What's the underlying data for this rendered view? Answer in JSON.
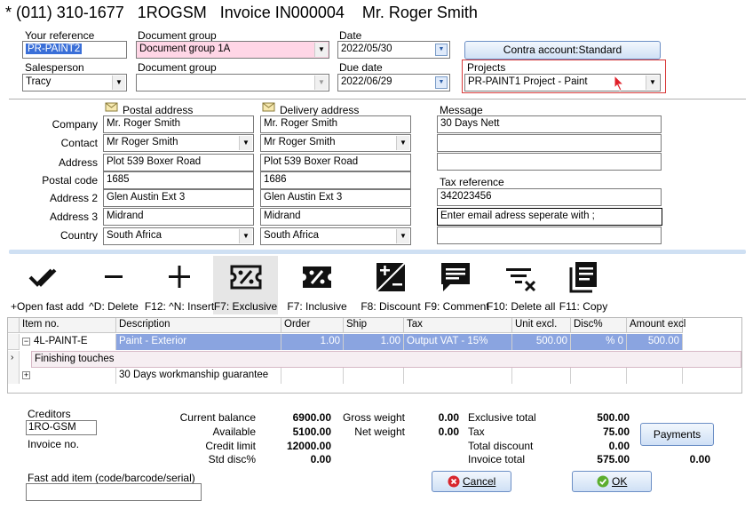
{
  "title": "* (011) 310-1677   1ROGSM   Invoice IN000004    Mr. Roger Smith",
  "header": {
    "your_reference_label": "Your reference",
    "your_reference_value": "PR-PAINT2",
    "doc_group_label": "Document group",
    "doc_group_value": "Document group 1A",
    "date_label": "Date",
    "date_value": "2022/05/30",
    "contra_button": "Contra account:Standard",
    "salesperson_label": "Salesperson",
    "salesperson_value": "Tracy",
    "doc_group2_label": "Document group",
    "doc_group2_value": "",
    "due_date_label": "Due date",
    "due_date_value": "2022/06/29",
    "projects_label": "Projects",
    "projects_value": "PR-PAINT1 Project - Paint"
  },
  "address": {
    "postal_label": "Postal address",
    "delivery_label": "Delivery address",
    "rows": [
      {
        "label": "Company",
        "postal": "Mr. Roger Smith",
        "delivery": "Mr. Roger Smith"
      },
      {
        "label": "Contact",
        "postal": "Mr Roger Smith",
        "delivery": "Mr Roger Smith"
      },
      {
        "label": "Address",
        "postal": "Plot 539 Boxer Road",
        "delivery": "Plot 539 Boxer Road"
      },
      {
        "label": "Postal code",
        "postal": "1685",
        "delivery": "1686"
      },
      {
        "label": "Address 2",
        "postal": "Glen Austin Ext 3",
        "delivery": "Glen Austin Ext 3"
      },
      {
        "label": "Address 3",
        "postal": "Midrand",
        "delivery": "Midrand"
      },
      {
        "label": "Country",
        "postal": "South Africa",
        "delivery": "South Africa"
      }
    ],
    "message_label": "Message",
    "message_lines": [
      "30 Days Nett",
      "",
      ""
    ],
    "tax_ref_label": "Tax reference",
    "tax_ref_value": "342023456",
    "email_value": "Enter email adress seperate with ;",
    "extra_value": ""
  },
  "toolbar": [
    {
      "label": "+Open fast add",
      "icon": "double-check-icon"
    },
    {
      "label": "^D: Delete",
      "icon": "minus-icon"
    },
    {
      "label": "F12: ^N: Insert",
      "icon": "plus-icon"
    },
    {
      "label": "F7: Exclusive",
      "icon": "ticket-percent-icon"
    },
    {
      "label": "F7: Inclusive",
      "icon": "ticket-percent-filled-icon"
    },
    {
      "label": "F8: Discount",
      "icon": "plus-minus-box-icon"
    },
    {
      "label": "F9: Comment",
      "icon": "comment-icon"
    },
    {
      "label": "F10: Delete all",
      "icon": "clear-filter-icon"
    },
    {
      "label": "F11: Copy",
      "icon": "copy-icon"
    }
  ],
  "grid": {
    "columns": [
      "Item no.",
      "Description",
      "Order",
      "Ship",
      "Tax",
      "Unit excl.",
      "Disc%",
      "Amount excl"
    ],
    "row1": {
      "item": "4L-PAINT-E",
      "description": "Paint - Exterior",
      "order": "1.00",
      "ship": "1.00",
      "tax": "Output VAT - 15%",
      "unit": "500.00",
      "disc": "% 0",
      "amount": "500.00"
    },
    "comment": "Finishing touches",
    "row2": {
      "item": "",
      "description": "30 Days workmanship guarantee"
    }
  },
  "footer": {
    "creditors_label": "Creditors",
    "creditors_value": "1RO-GSM",
    "invoice_no_label": "Invoice no.",
    "current_balance_label": "Current balance",
    "current_balance": "6900.00",
    "available_label": "Available",
    "available": "5100.00",
    "credit_limit_label": "Credit limit",
    "credit_limit": "12000.00",
    "std_disc_label": "Std disc%",
    "std_disc": "0.00",
    "gross_weight_label": "Gross weight",
    "gross_weight": "0.00",
    "net_weight_label": "Net weight",
    "net_weight": "0.00",
    "exclusive_total_label": "Exclusive total",
    "exclusive_total": "500.00",
    "tax_label": "Tax",
    "tax": "75.00",
    "total_discount_label": "Total discount",
    "total_discount": "0.00",
    "invoice_total_label": "Invoice total",
    "invoice_total": "575.00",
    "payments_button": "Payments",
    "payments_value": "0.00",
    "fast_add_label": "Fast add item (code/barcode/serial)",
    "fast_add_value": "",
    "cancel_button": "Cancel",
    "ok_button": "OK"
  }
}
